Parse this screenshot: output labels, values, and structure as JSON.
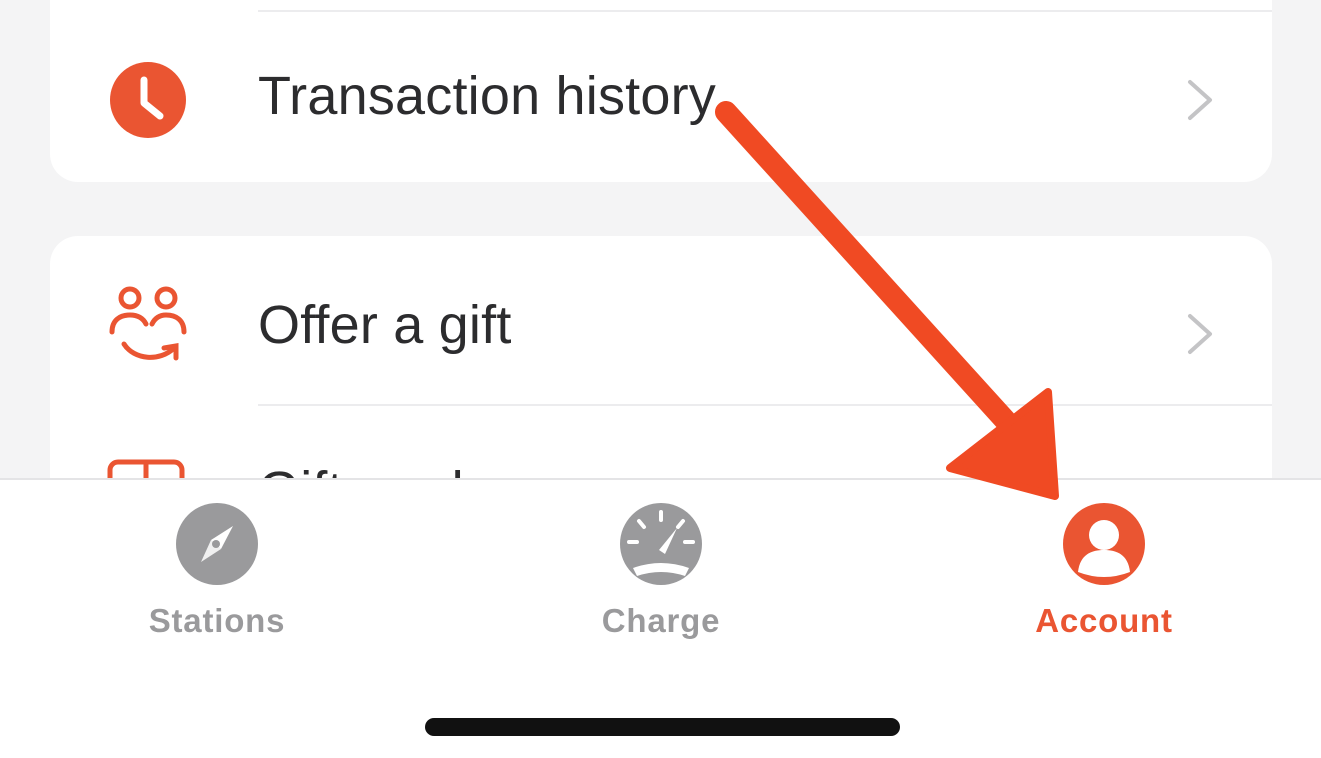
{
  "menu": {
    "transaction_history": {
      "label": "Transaction history",
      "icon": "clock-icon"
    },
    "offer_gift": {
      "label": "Offer a gift",
      "icon": "people-gift-icon"
    },
    "gift_cards": {
      "label": "Gift cards",
      "icon": "gift-card-icon"
    }
  },
  "tabbar": {
    "tabs": [
      {
        "label": "Stations",
        "icon": "compass-icon",
        "active": false
      },
      {
        "label": "Charge",
        "icon": "speedometer-icon",
        "active": false
      },
      {
        "label": "Account",
        "icon": "person-icon",
        "active": true
      }
    ]
  },
  "annotation": {
    "type": "arrow",
    "points_to": "Account",
    "color": "#f04a23"
  },
  "colors": {
    "accent": "#ea5532",
    "inactive": "#9a9a9c",
    "text": "#2c2c2e",
    "background": "#f4f4f5"
  }
}
